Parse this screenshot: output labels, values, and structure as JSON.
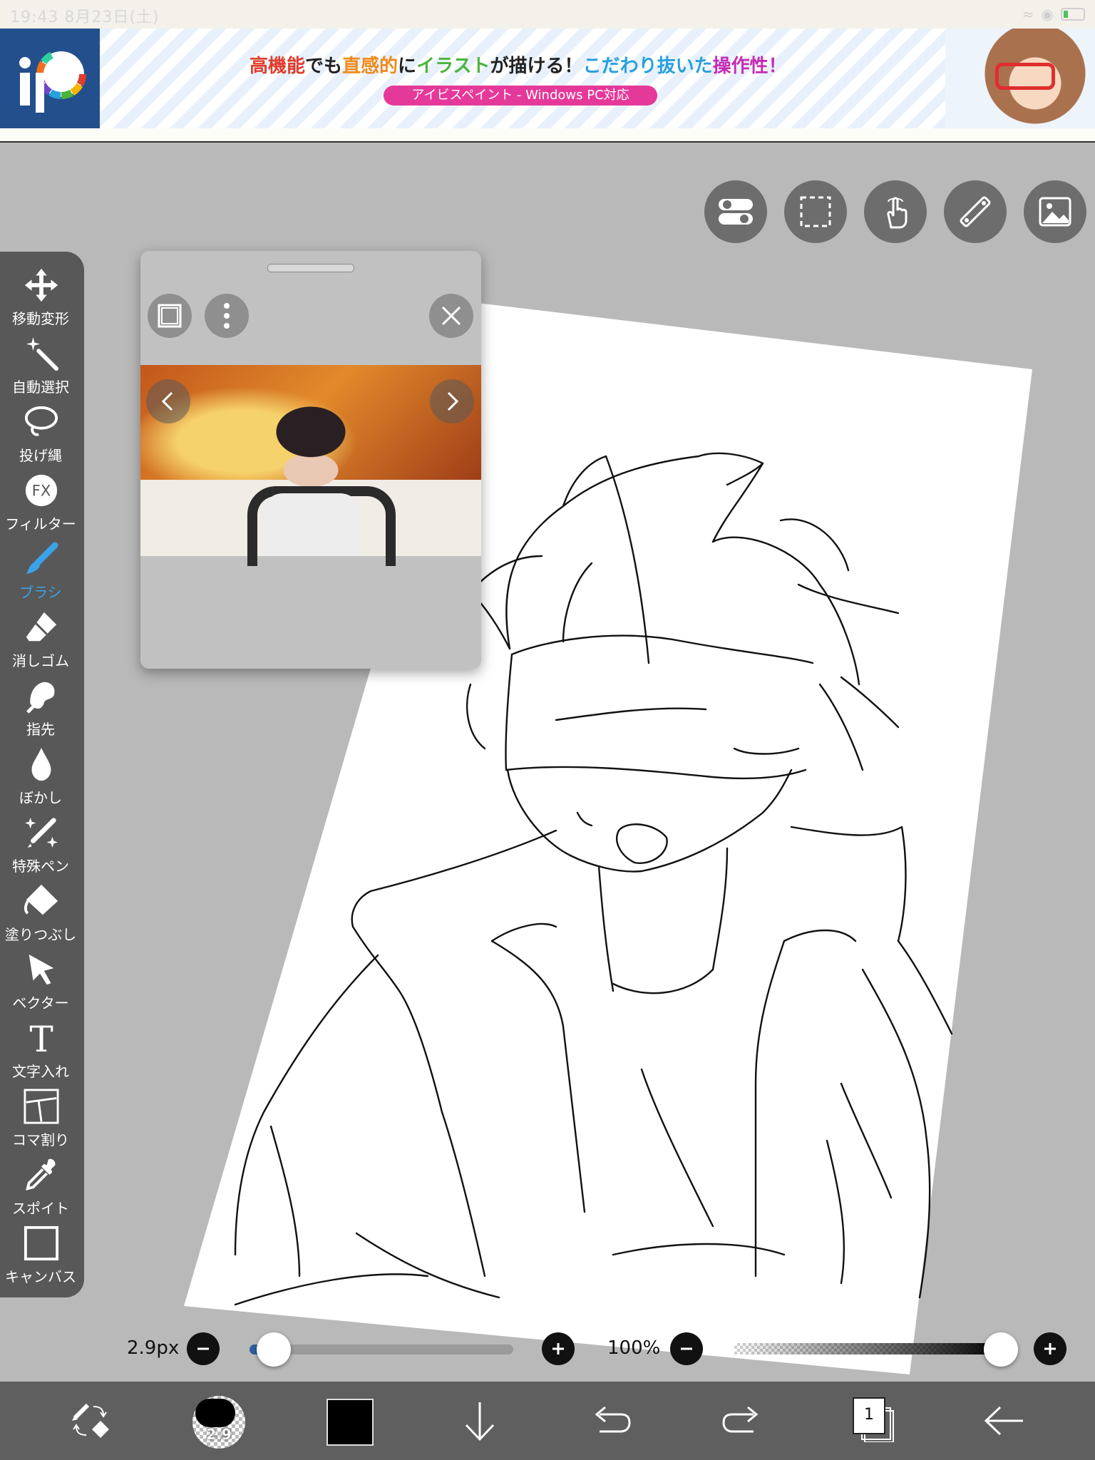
{
  "status": {
    "time": "19:43",
    "date": "8月23日(土)"
  },
  "ad": {
    "title_parts": [
      "高機能",
      "でも",
      "直感的",
      "に",
      "イラスト",
      "が描ける！",
      "こだわり抜いた",
      "操作性",
      "！"
    ],
    "pill": "アイビスペイント - Windows PC対応",
    "logo_text": "iP"
  },
  "tools": [
    {
      "label": "移動変形",
      "icon": "move-icon"
    },
    {
      "label": "自動選択",
      "icon": "magic-wand-icon"
    },
    {
      "label": "投げ縄",
      "icon": "lasso-icon"
    },
    {
      "label": "フィルター",
      "icon": "fx-filter-icon",
      "icon_text": "FX"
    },
    {
      "label": "ブラシ",
      "icon": "brush-icon",
      "active": true
    },
    {
      "label": "消しゴム",
      "icon": "eraser-icon"
    },
    {
      "label": "指先",
      "icon": "finger-smudge-icon"
    },
    {
      "label": "ぼかし",
      "icon": "blur-drop-icon"
    },
    {
      "label": "特殊ペン",
      "icon": "special-pen-icon"
    },
    {
      "label": "塗りつぶし",
      "icon": "fill-bucket-icon"
    },
    {
      "label": "ベクター",
      "icon": "vector-cursor-icon"
    },
    {
      "label": "文字入れ",
      "icon": "text-icon",
      "icon_text": "T"
    },
    {
      "label": "コマ割り",
      "icon": "frame-divider-icon"
    },
    {
      "label": "スポイト",
      "icon": "eyedropper-icon"
    },
    {
      "label": "キャンバス",
      "icon": "canvas-icon"
    }
  ],
  "top_buttons": [
    "toggle-icon",
    "selection-icon",
    "touch-icon",
    "ruler-icon",
    "image-icon"
  ],
  "brush": {
    "size_label": "2.9px",
    "size_fraction": 0.04,
    "preview_label": "2.9"
  },
  "opacity": {
    "label": "100%",
    "value_fraction": 1.0
  },
  "layers": {
    "count": "1"
  },
  "colors": {
    "accent": "#3aa2e8",
    "toolbar_bg": "#585858",
    "bottombar_bg": "#5f5f5f",
    "workspace_bg": "#b9b9b9",
    "current_color": "#000000"
  }
}
